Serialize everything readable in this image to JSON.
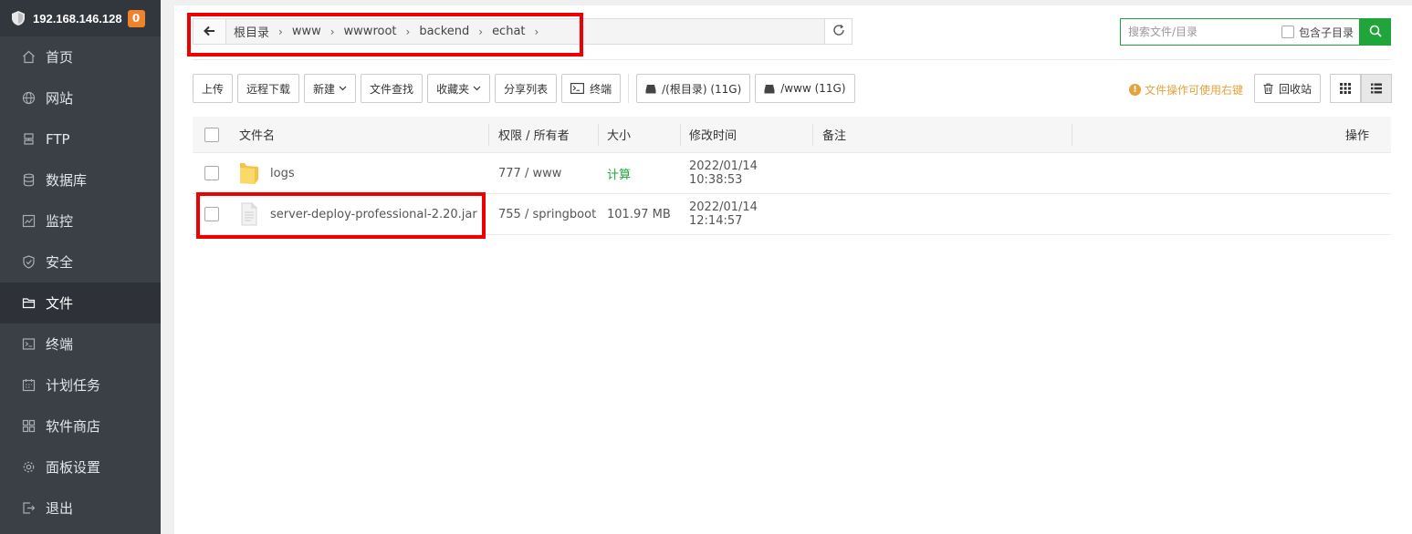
{
  "sidebar": {
    "server_ip": "192.168.146.128",
    "badge": "0",
    "items": [
      {
        "label": "首页",
        "icon": "home-icon"
      },
      {
        "label": "网站",
        "icon": "globe-icon"
      },
      {
        "label": "FTP",
        "icon": "ftp-icon"
      },
      {
        "label": "数据库",
        "icon": "database-icon"
      },
      {
        "label": "监控",
        "icon": "monitor-icon"
      },
      {
        "label": "安全",
        "icon": "shield-icon"
      },
      {
        "label": "文件",
        "icon": "folder-icon",
        "active": true
      },
      {
        "label": "终端",
        "icon": "terminal-icon"
      },
      {
        "label": "计划任务",
        "icon": "calendar-icon"
      },
      {
        "label": "软件商店",
        "icon": "apps-icon"
      },
      {
        "label": "面板设置",
        "icon": "gear-icon"
      },
      {
        "label": "退出",
        "icon": "logout-icon"
      }
    ]
  },
  "breadcrumb": [
    "根目录",
    "www",
    "wwwroot",
    "backend",
    "echat"
  ],
  "search": {
    "placeholder": "搜索文件/目录",
    "include_sub_label": "包含子目录"
  },
  "toolbar": {
    "upload": "上传",
    "remote_download": "远程下载",
    "new": "新建",
    "find": "文件查找",
    "favorites": "收藏夹",
    "share_list": "分享列表",
    "terminal": "终端",
    "disk_root": "/(根目录) (11G)",
    "disk_www": "/www (11G)",
    "tip": "文件操作可使用右键",
    "recycle": "回收站"
  },
  "table": {
    "headers": {
      "name": "文件名",
      "perm": "权限 / 所有者",
      "size": "大小",
      "mtime": "修改时间",
      "note": "备注",
      "ops": "操作"
    },
    "rows": [
      {
        "type": "folder",
        "name": "logs",
        "perm": "777 / www",
        "size": "计算",
        "mtime": "2022/01/14 10:38:53",
        "note": ""
      },
      {
        "type": "file",
        "name": "server-deploy-professional-2.20.jar",
        "perm": "755 / springboot",
        "size": "101.97 MB",
        "mtime": "2022/01/14 12:14:57",
        "note": ""
      }
    ]
  },
  "colors": {
    "accent": "#20a53a",
    "sidebar_bg": "#3b4047",
    "highlight": "#ee0000",
    "tip": "#e6a23c"
  }
}
